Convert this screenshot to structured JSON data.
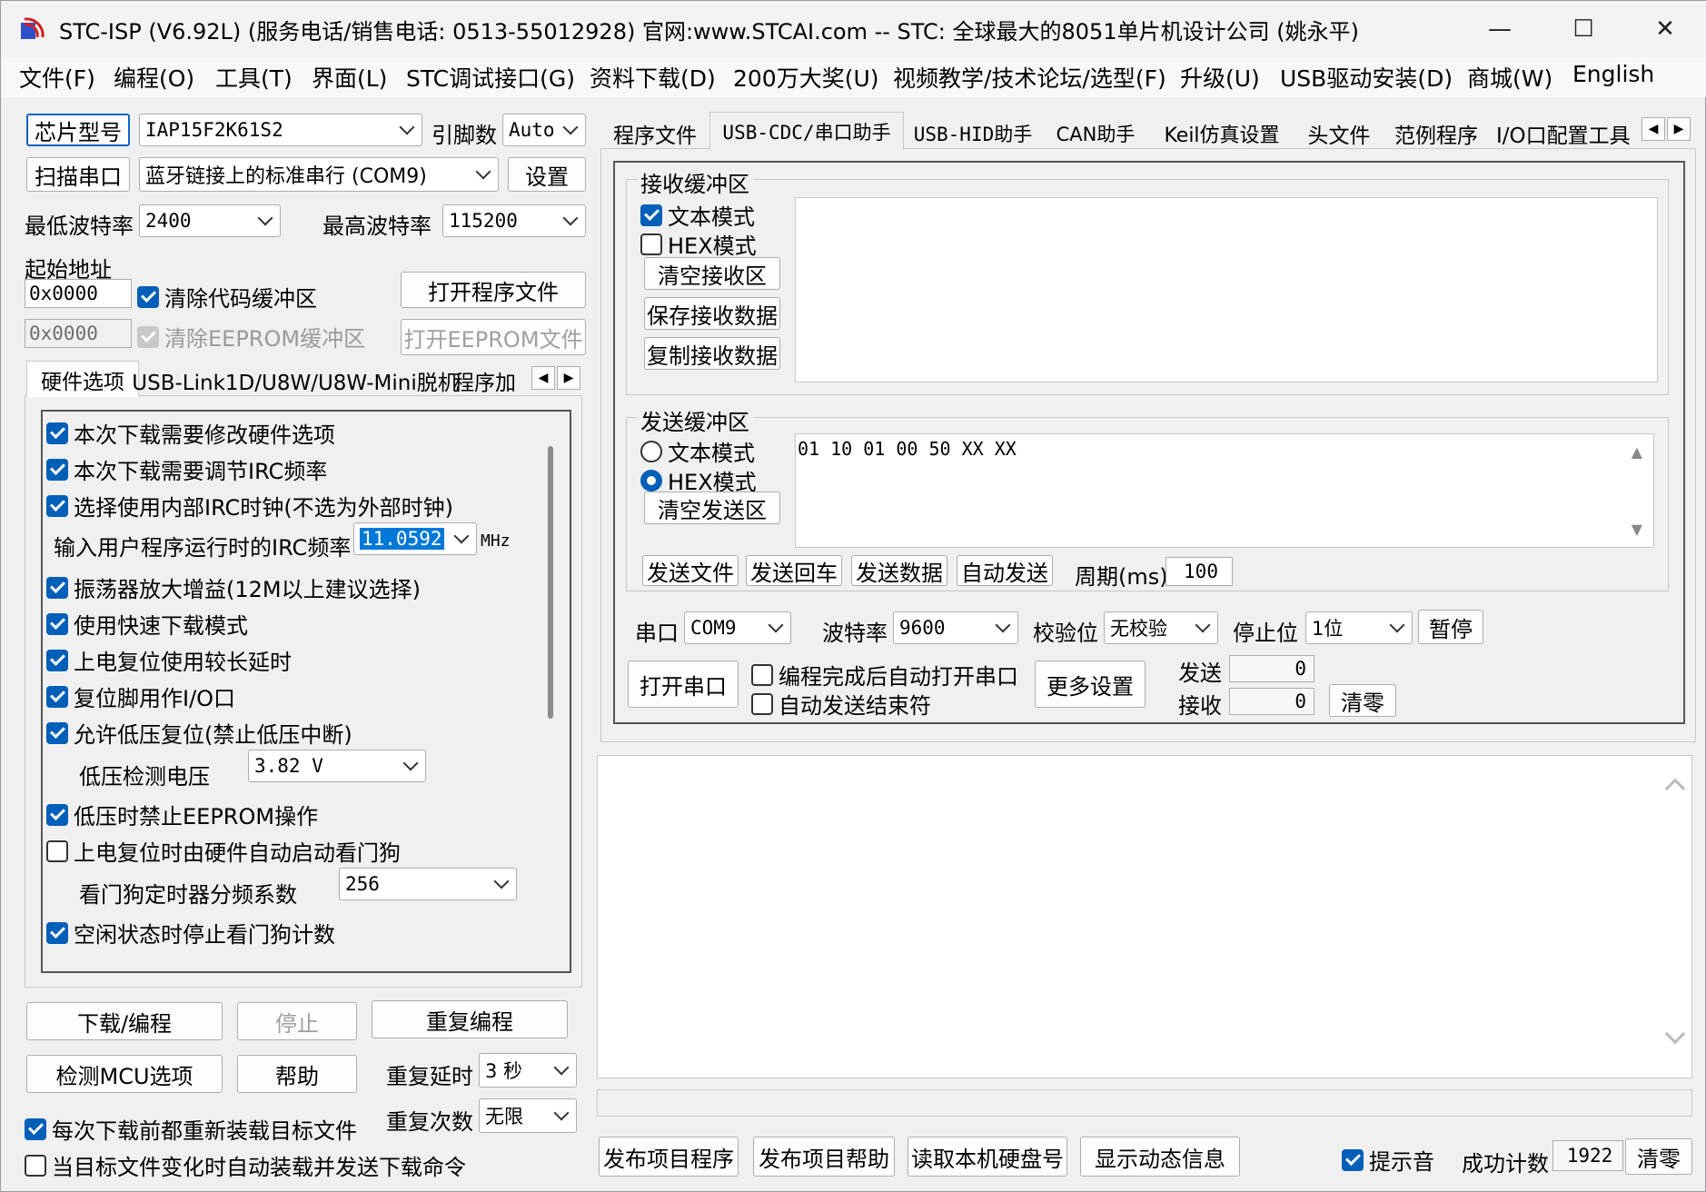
{
  "window": {
    "title": "STC-ISP (V6.92L) (服务电话/销售电话: 0513-55012928) 官网:www.STCAI.com  -- STC: 全球最大的8051单片机设计公司 (姚永平)",
    "min_glyph": "—",
    "max_glyph": "☐",
    "close_glyph": "✕"
  },
  "menu": [
    "文件(F)",
    "编程(O)",
    "工具(T)",
    "界面(L)",
    "STC调试接口(G)",
    "资料下载(D)",
    "200万大奖(U)",
    "视频教学/技术论坛/选型(F)",
    "升级(U)",
    "USB驱动安装(D)",
    "商城(W)",
    "English"
  ],
  "left": {
    "chip_label": "芯片型号",
    "chip_value": "IAP15F2K61S2",
    "pins_label": "引脚数",
    "pins_value": "Auto",
    "scan_label": "扫描串口",
    "port_value": "蓝牙链接上的标准串行 (COM9)",
    "settings_label": "设置",
    "min_baud_label": "最低波特率",
    "min_baud_value": "2400",
    "max_baud_label": "最高波特率",
    "max_baud_value": "115200",
    "start_addr_label": "起始地址",
    "code_addr": "0x0000",
    "clear_code_label": "清除代码缓冲区",
    "open_prog_label": "打开程序文件",
    "eeprom_addr": "0x0000",
    "clear_eeprom_label": "清除EEPROM缓冲区",
    "open_eeprom_label": "打开EEPROM文件",
    "tabs": [
      "硬件选项",
      "USB-Link1D/U8W/U8W-Mini脱机",
      "程序加"
    ],
    "options": {
      "o1": "本次下载需要修改硬件选项",
      "o2": "本次下载需要调节IRC频率",
      "o3": "选择使用内部IRC时钟(不选为外部时钟)",
      "irc_label": "输入用户程序运行时的IRC频率",
      "irc_value": "11.0592",
      "irc_unit": "MHz",
      "o4": "振荡器放大增益(12M以上建议选择)",
      "o5": "使用快速下载模式",
      "o6": "上电复位使用较长延时",
      "o7": "复位脚用作I/O口",
      "o8": "允许低压复位(禁止低压中断)",
      "lv_label": "低压检测电压",
      "lv_value": "3.82 V",
      "o9": "低压时禁止EEPROM操作",
      "o10": "上电复位时由硬件自动启动看门狗",
      "wdt_label": "看门狗定时器分频系数",
      "wdt_value": "256",
      "o11": "空闲状态时停止看门狗计数"
    },
    "download_label": "下载/编程",
    "stop_label": "停止",
    "reprog_label": "重复编程",
    "detect_label": "检测MCU选项",
    "help_label": "帮助",
    "repeat_delay_label": "重复延时",
    "repeat_delay_value": "3 秒",
    "repeat_count_label": "重复次数",
    "repeat_count_value": "无限",
    "reload_label": "每次下载前都重新装载目标文件",
    "autoload_label": "当目标文件变化时自动装载并发送下载命令"
  },
  "right": {
    "tabs": [
      "程序文件",
      "USB-CDC/串口助手",
      "USB-HID助手",
      "CAN助手",
      "Keil仿真设置",
      "头文件",
      "范例程序",
      "I/O口配置工具"
    ],
    "recv_title": "接收缓冲区",
    "recv_text_mode": "文本模式",
    "recv_hex_mode": "HEX模式",
    "clear_recv": "清空接收区",
    "save_recv": "保存接收数据",
    "copy_recv": "复制接收数据",
    "send_title": "发送缓冲区",
    "send_text_mode": "文本模式",
    "send_hex_mode": "HEX模式",
    "clear_send": "清空发送区",
    "send_content": "01 10 01 00 50 XX XX",
    "send_file": "发送文件",
    "send_return": "发送回车",
    "send_data": "发送数据",
    "auto_send": "自动发送",
    "period_label": "周期(ms)",
    "period_value": "100",
    "port_label": "串口",
    "port_value": "COM9",
    "baud_label": "波特率",
    "baud_value": "9600",
    "parity_label": "校验位",
    "parity_value": "无校验",
    "stop_label": "停止位",
    "stop_value": "1位",
    "pause_label": "暂停",
    "open_port_label": "打开串口",
    "auto_open_label": "编程完成后自动打开串口",
    "auto_end_label": "自动发送结束符",
    "more_label": "更多设置",
    "tx_label": "发送",
    "tx_value": "0",
    "rx_label": "接收",
    "rx_value": "0",
    "clear_label": "清零",
    "publish_prog": "发布项目程序",
    "publish_help": "发布项目帮助",
    "read_disk": "读取本机硬盘号",
    "show_dynamic": "显示动态信息",
    "beep_label": "提示音",
    "success_label": "成功计数",
    "success_value": "1922",
    "clear_count": "清零"
  }
}
